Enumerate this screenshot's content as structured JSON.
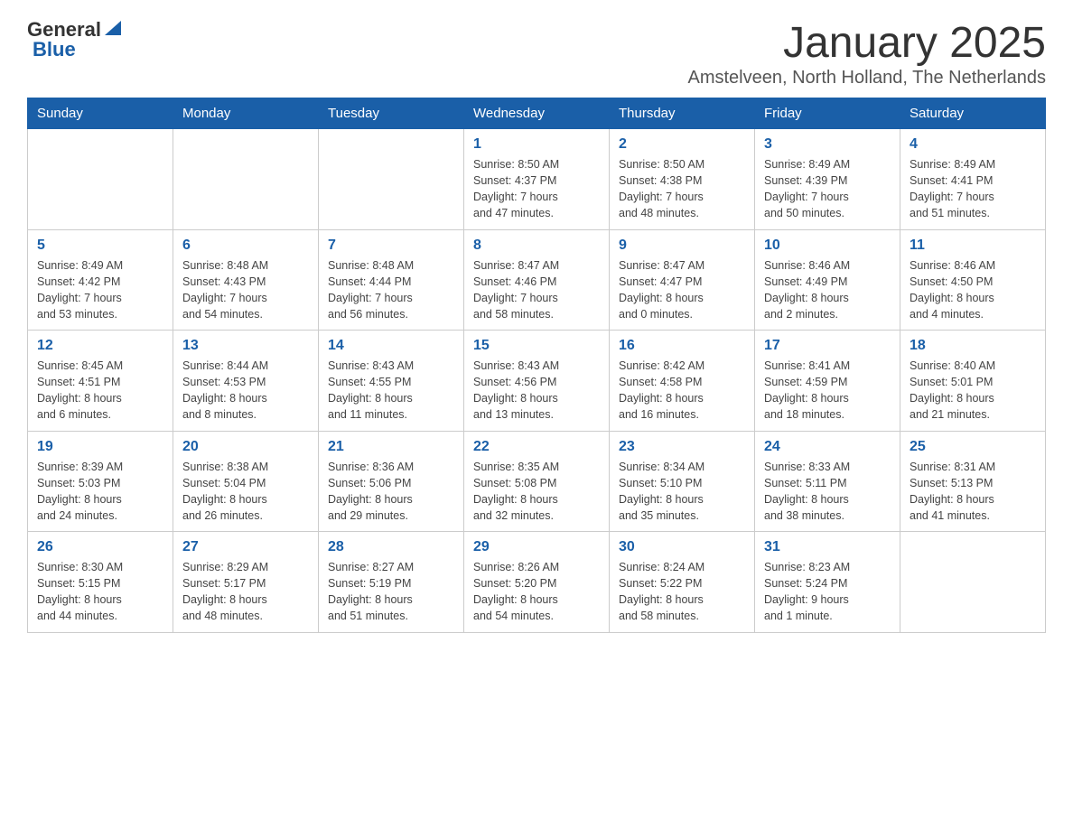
{
  "header": {
    "logo_general": "General",
    "logo_blue": "Blue",
    "month_title": "January 2025",
    "subtitle": "Amstelveen, North Holland, The Netherlands"
  },
  "weekdays": [
    "Sunday",
    "Monday",
    "Tuesday",
    "Wednesday",
    "Thursday",
    "Friday",
    "Saturday"
  ],
  "weeks": [
    [
      {
        "day": "",
        "info": ""
      },
      {
        "day": "",
        "info": ""
      },
      {
        "day": "",
        "info": ""
      },
      {
        "day": "1",
        "info": "Sunrise: 8:50 AM\nSunset: 4:37 PM\nDaylight: 7 hours\nand 47 minutes."
      },
      {
        "day": "2",
        "info": "Sunrise: 8:50 AM\nSunset: 4:38 PM\nDaylight: 7 hours\nand 48 minutes."
      },
      {
        "day": "3",
        "info": "Sunrise: 8:49 AM\nSunset: 4:39 PM\nDaylight: 7 hours\nand 50 minutes."
      },
      {
        "day": "4",
        "info": "Sunrise: 8:49 AM\nSunset: 4:41 PM\nDaylight: 7 hours\nand 51 minutes."
      }
    ],
    [
      {
        "day": "5",
        "info": "Sunrise: 8:49 AM\nSunset: 4:42 PM\nDaylight: 7 hours\nand 53 minutes."
      },
      {
        "day": "6",
        "info": "Sunrise: 8:48 AM\nSunset: 4:43 PM\nDaylight: 7 hours\nand 54 minutes."
      },
      {
        "day": "7",
        "info": "Sunrise: 8:48 AM\nSunset: 4:44 PM\nDaylight: 7 hours\nand 56 minutes."
      },
      {
        "day": "8",
        "info": "Sunrise: 8:47 AM\nSunset: 4:46 PM\nDaylight: 7 hours\nand 58 minutes."
      },
      {
        "day": "9",
        "info": "Sunrise: 8:47 AM\nSunset: 4:47 PM\nDaylight: 8 hours\nand 0 minutes."
      },
      {
        "day": "10",
        "info": "Sunrise: 8:46 AM\nSunset: 4:49 PM\nDaylight: 8 hours\nand 2 minutes."
      },
      {
        "day": "11",
        "info": "Sunrise: 8:46 AM\nSunset: 4:50 PM\nDaylight: 8 hours\nand 4 minutes."
      }
    ],
    [
      {
        "day": "12",
        "info": "Sunrise: 8:45 AM\nSunset: 4:51 PM\nDaylight: 8 hours\nand 6 minutes."
      },
      {
        "day": "13",
        "info": "Sunrise: 8:44 AM\nSunset: 4:53 PM\nDaylight: 8 hours\nand 8 minutes."
      },
      {
        "day": "14",
        "info": "Sunrise: 8:43 AM\nSunset: 4:55 PM\nDaylight: 8 hours\nand 11 minutes."
      },
      {
        "day": "15",
        "info": "Sunrise: 8:43 AM\nSunset: 4:56 PM\nDaylight: 8 hours\nand 13 minutes."
      },
      {
        "day": "16",
        "info": "Sunrise: 8:42 AM\nSunset: 4:58 PM\nDaylight: 8 hours\nand 16 minutes."
      },
      {
        "day": "17",
        "info": "Sunrise: 8:41 AM\nSunset: 4:59 PM\nDaylight: 8 hours\nand 18 minutes."
      },
      {
        "day": "18",
        "info": "Sunrise: 8:40 AM\nSunset: 5:01 PM\nDaylight: 8 hours\nand 21 minutes."
      }
    ],
    [
      {
        "day": "19",
        "info": "Sunrise: 8:39 AM\nSunset: 5:03 PM\nDaylight: 8 hours\nand 24 minutes."
      },
      {
        "day": "20",
        "info": "Sunrise: 8:38 AM\nSunset: 5:04 PM\nDaylight: 8 hours\nand 26 minutes."
      },
      {
        "day": "21",
        "info": "Sunrise: 8:36 AM\nSunset: 5:06 PM\nDaylight: 8 hours\nand 29 minutes."
      },
      {
        "day": "22",
        "info": "Sunrise: 8:35 AM\nSunset: 5:08 PM\nDaylight: 8 hours\nand 32 minutes."
      },
      {
        "day": "23",
        "info": "Sunrise: 8:34 AM\nSunset: 5:10 PM\nDaylight: 8 hours\nand 35 minutes."
      },
      {
        "day": "24",
        "info": "Sunrise: 8:33 AM\nSunset: 5:11 PM\nDaylight: 8 hours\nand 38 minutes."
      },
      {
        "day": "25",
        "info": "Sunrise: 8:31 AM\nSunset: 5:13 PM\nDaylight: 8 hours\nand 41 minutes."
      }
    ],
    [
      {
        "day": "26",
        "info": "Sunrise: 8:30 AM\nSunset: 5:15 PM\nDaylight: 8 hours\nand 44 minutes."
      },
      {
        "day": "27",
        "info": "Sunrise: 8:29 AM\nSunset: 5:17 PM\nDaylight: 8 hours\nand 48 minutes."
      },
      {
        "day": "28",
        "info": "Sunrise: 8:27 AM\nSunset: 5:19 PM\nDaylight: 8 hours\nand 51 minutes."
      },
      {
        "day": "29",
        "info": "Sunrise: 8:26 AM\nSunset: 5:20 PM\nDaylight: 8 hours\nand 54 minutes."
      },
      {
        "day": "30",
        "info": "Sunrise: 8:24 AM\nSunset: 5:22 PM\nDaylight: 8 hours\nand 58 minutes."
      },
      {
        "day": "31",
        "info": "Sunrise: 8:23 AM\nSunset: 5:24 PM\nDaylight: 9 hours\nand 1 minute."
      },
      {
        "day": "",
        "info": ""
      }
    ]
  ]
}
